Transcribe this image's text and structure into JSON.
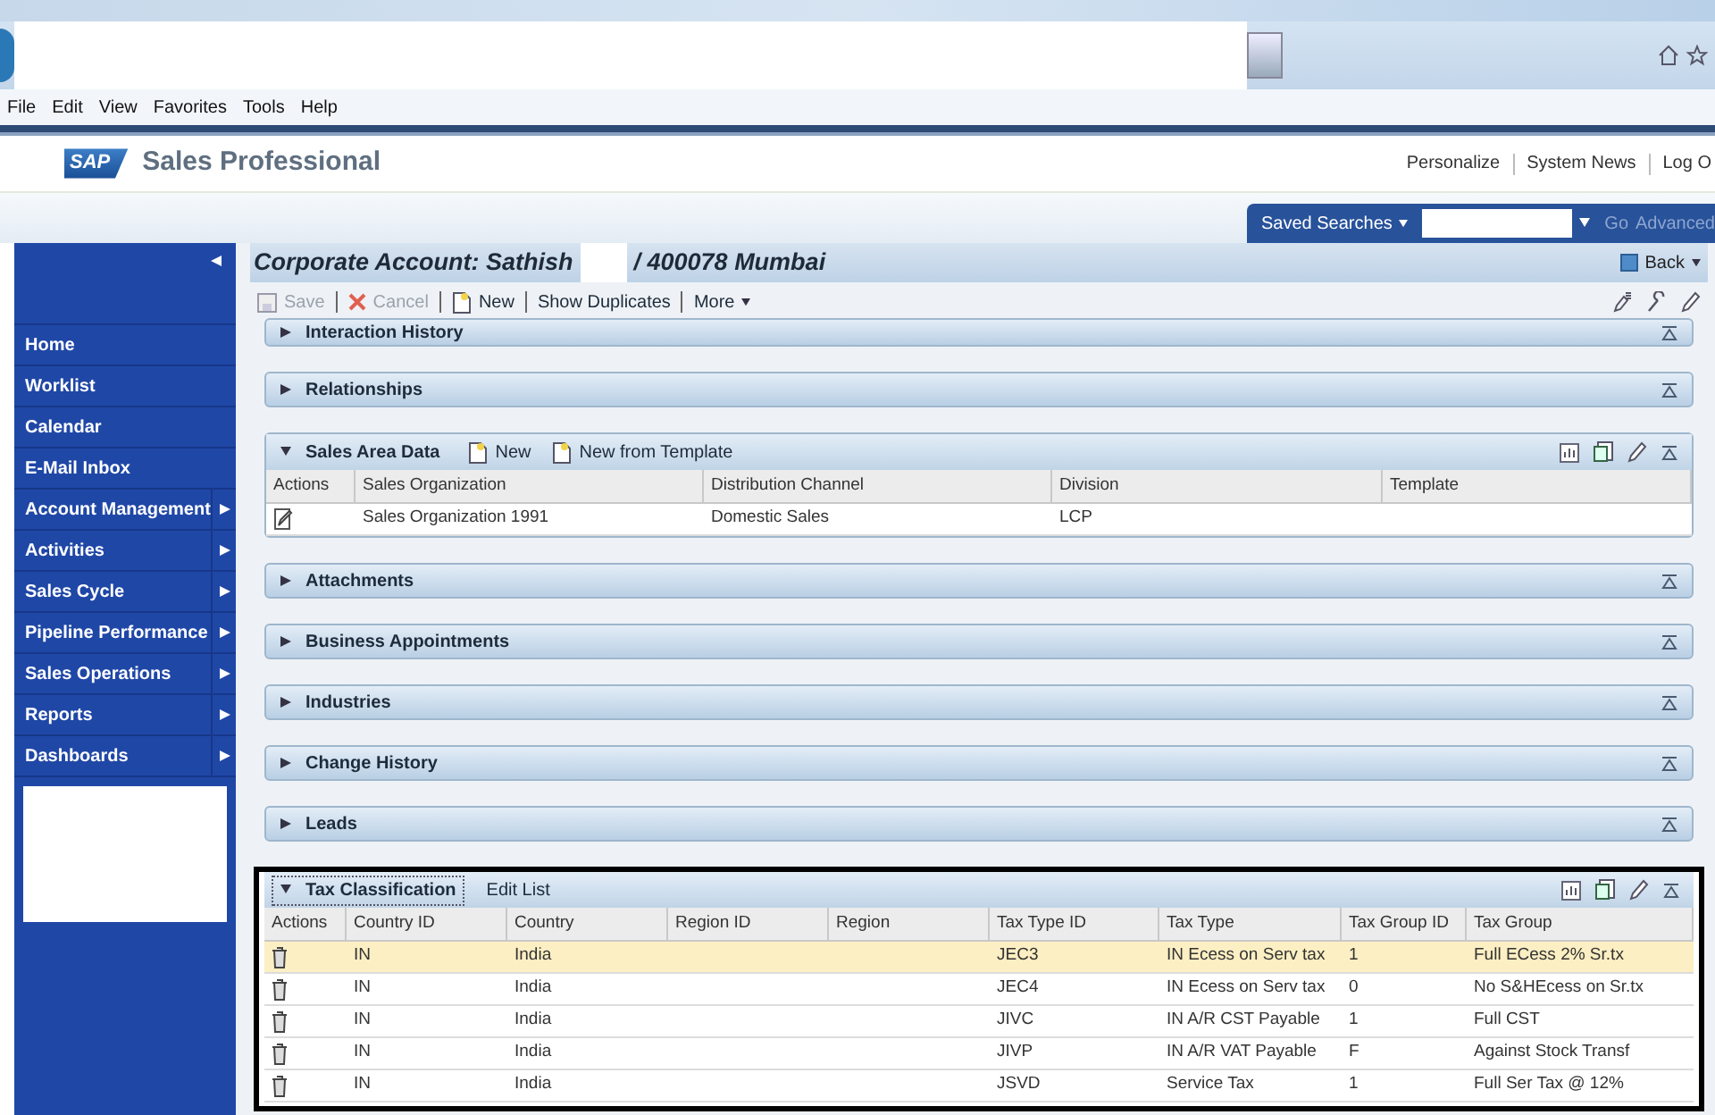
{
  "browser": {
    "menu": [
      "File",
      "Edit",
      "View",
      "Favorites",
      "Tools",
      "Help"
    ]
  },
  "header": {
    "logo": "SAP",
    "app_name": "Sales Professional",
    "links": [
      "Personalize",
      "System News",
      "Log O"
    ]
  },
  "search": {
    "saved_searches": "Saved Searches",
    "go": "Go",
    "advanced": "Advanced"
  },
  "page_title": {
    "prefix": "Corporate Account: Sathish",
    "suffix": "/ 400078 Mumbai",
    "back": "Back"
  },
  "toolbar": [
    {
      "label": "Save",
      "kind": "save",
      "disabled": true
    },
    {
      "label": "Cancel",
      "kind": "cancel",
      "disabled": true
    },
    {
      "label": "New",
      "kind": "new",
      "disabled": false
    },
    {
      "label": "Show Duplicates",
      "kind": "plain",
      "disabled": false
    },
    {
      "label": "More",
      "kind": "more",
      "disabled": false
    }
  ],
  "sidebar": {
    "items": [
      {
        "label": "Home",
        "submenu": false
      },
      {
        "label": "Worklist",
        "submenu": false
      },
      {
        "label": "Calendar",
        "submenu": false
      },
      {
        "label": "E-Mail Inbox",
        "submenu": false
      },
      {
        "label": "Account Management",
        "submenu": true
      },
      {
        "label": "Activities",
        "submenu": true
      },
      {
        "label": "Sales Cycle",
        "submenu": true
      },
      {
        "label": "Pipeline Performance",
        "submenu": true
      },
      {
        "label": "Sales Operations",
        "submenu": true
      },
      {
        "label": "Reports",
        "submenu": true
      },
      {
        "label": "Dashboards",
        "submenu": true
      }
    ]
  },
  "sections": [
    {
      "title": "Interaction History",
      "expanded": false
    },
    {
      "title": "Relationships",
      "expanded": false
    },
    {
      "title": "Sales Area Data",
      "expanded": true,
      "actions": [
        {
          "label": "New",
          "kind": "new"
        },
        {
          "label": "New from Template",
          "kind": "new"
        }
      ],
      "columns": [
        "Actions",
        "Sales Organization",
        "Distribution Channel",
        "Division",
        "Template"
      ],
      "rows": [
        {
          "selected": false,
          "kind": "edit",
          "cells": [
            "",
            "Sales Organization 1991",
            "Domestic Sales",
            "LCP",
            ""
          ]
        }
      ]
    },
    {
      "title": "Attachments",
      "expanded": false
    },
    {
      "title": "Business Appointments",
      "expanded": false
    },
    {
      "title": "Industries",
      "expanded": false
    },
    {
      "title": "Change History",
      "expanded": false
    },
    {
      "title": "Leads",
      "expanded": false
    },
    {
      "title": "Tax Classification",
      "expanded": true,
      "focused": true,
      "actions": [
        {
          "label": "Edit List",
          "kind": "plain"
        }
      ],
      "columns": [
        "Actions",
        "Country ID",
        "Country",
        "Region ID",
        "Region",
        "Tax Type ID",
        "Tax Type",
        "Tax Group ID",
        "Tax Group"
      ],
      "rows": [
        {
          "selected": true,
          "kind": "delete",
          "cells": [
            "",
            "IN",
            "India",
            "",
            "",
            "JEC3",
            "IN Ecess on Serv tax",
            "1",
            "Full ECess 2% Sr.tx"
          ]
        },
        {
          "selected": false,
          "kind": "delete",
          "cells": [
            "",
            "IN",
            "India",
            "",
            "",
            "JEC4",
            "IN Ecess on Serv tax",
            "0",
            "No S&HEcess on Sr.tx"
          ]
        },
        {
          "selected": false,
          "kind": "delete",
          "cells": [
            "",
            "IN",
            "India",
            "",
            "",
            "JIVC",
            "IN A/R CST Payable",
            "1",
            "Full CST"
          ]
        },
        {
          "selected": false,
          "kind": "delete",
          "cells": [
            "",
            "IN",
            "India",
            "",
            "",
            "JIVP",
            "IN A/R VAT Payable",
            "F",
            "Against Stock Transf"
          ]
        },
        {
          "selected": false,
          "kind": "delete",
          "cells": [
            "",
            "IN",
            "India",
            "",
            "",
            "JSVD",
            "Service Tax",
            "1",
            "Full Ser Tax @ 12%"
          ]
        }
      ]
    }
  ]
}
